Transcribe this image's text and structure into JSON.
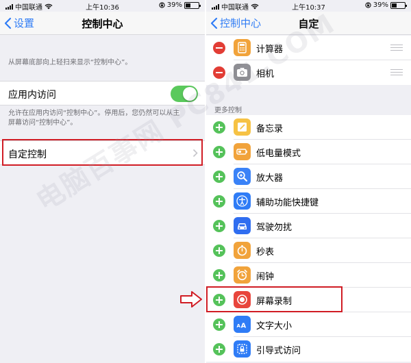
{
  "accent": "#2f7cf6",
  "highlight_color": "#d01c24",
  "left": {
    "status": {
      "carrier": "中国联通",
      "time": "上午10:36",
      "battery": "39%"
    },
    "nav": {
      "back": "设置",
      "title": "控制中心"
    },
    "intro_note": "从屏幕底部向上轻扫来显示“控制中心”。",
    "toggle": {
      "label": "应用内访问",
      "on": true
    },
    "toggle_note": [
      "允许在应用内访问“控制中心”。停用后，您仍然可以从主",
      "屏幕访问“控制中心”。"
    ],
    "customize": {
      "label": "自定控制"
    }
  },
  "right": {
    "status": {
      "carrier": "中国联通",
      "time": "上午10:37",
      "battery": "39%"
    },
    "nav": {
      "back": "控制中心",
      "title": "自定"
    },
    "included": [
      {
        "label": "计算器",
        "icon": "calculator-icon"
      },
      {
        "label": "相机",
        "icon": "camera-icon"
      }
    ],
    "more_header": "更多控制",
    "more": [
      {
        "label": "备忘录",
        "icon": "notes-icon"
      },
      {
        "label": "低电量模式",
        "icon": "low-power-icon"
      },
      {
        "label": "放大器",
        "icon": "magnifier-icon"
      },
      {
        "label": "辅助功能快捷键",
        "icon": "accessibility-icon"
      },
      {
        "label": "驾驶勿扰",
        "icon": "car-icon"
      },
      {
        "label": "秒表",
        "icon": "stopwatch-icon"
      },
      {
        "label": "闹钟",
        "icon": "alarm-icon"
      },
      {
        "label": "屏幕录制",
        "icon": "screen-record-icon"
      },
      {
        "label": "文字大小",
        "icon": "text-size-icon"
      },
      {
        "label": "引导式访问",
        "icon": "guided-access-icon"
      }
    ]
  },
  "watermark": "电脑百事网 PC841.COM"
}
